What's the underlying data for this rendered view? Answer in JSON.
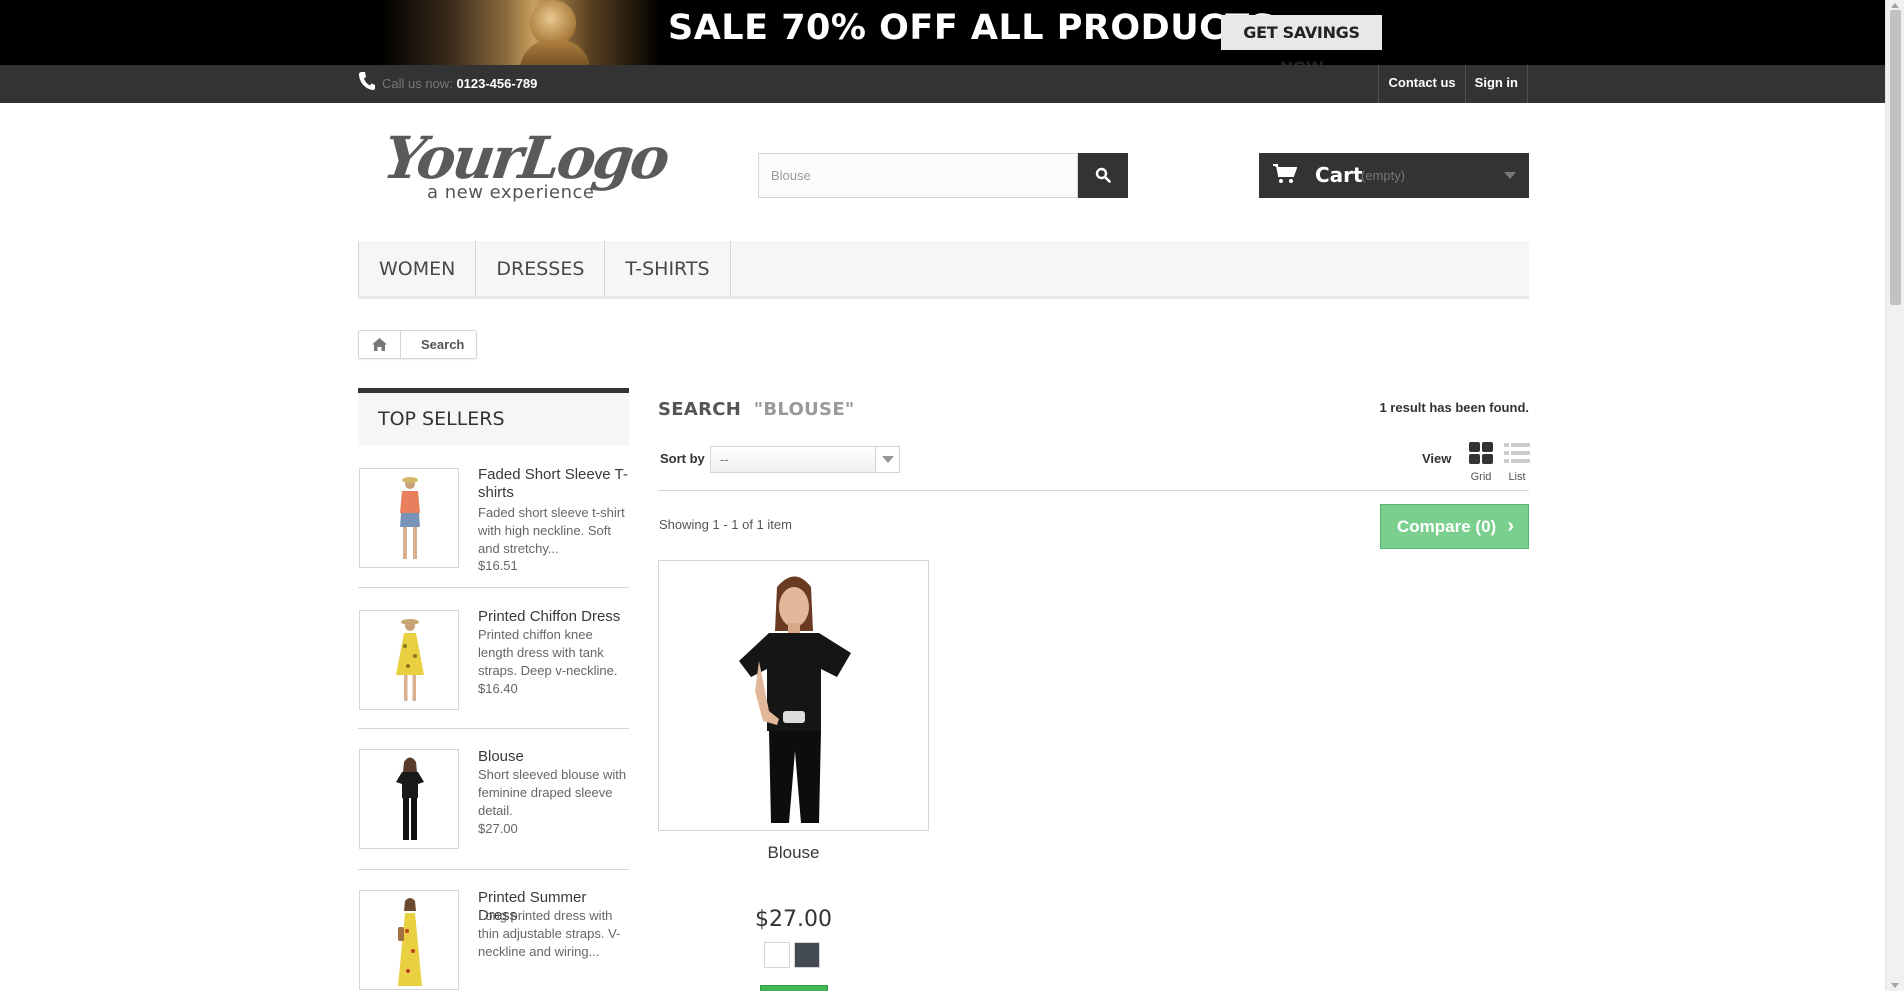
{
  "banner": {
    "text": "SALE 70% OFF ALL PRODUCTS",
    "button": "GET SAVINGS NOW"
  },
  "topbar": {
    "call_label": "Call us now:",
    "phone": "0123-456-789",
    "contact": "Contact us",
    "signin": "Sign in"
  },
  "logo": {
    "main": "YourLogo",
    "tagline": "a new experience"
  },
  "search": {
    "value": "Blouse"
  },
  "cart": {
    "label": "Cart",
    "status": "(empty)"
  },
  "menu": [
    "WOMEN",
    "DRESSES",
    "T-SHIRTS"
  ],
  "breadcrumb": {
    "current": "Search"
  },
  "sidebar": {
    "title": "TOP SELLERS",
    "items": [
      {
        "name": "Faded Short Sleeve T-shirts",
        "desc": "Faded short sleeve t-shirt with high neckline. Soft and stretchy...",
        "price": "$16.51"
      },
      {
        "name": "Printed Chiffon Dress",
        "desc": "Printed chiffon knee length dress with tank straps. Deep v-neckline.",
        "price": "$16.40"
      },
      {
        "name": "Blouse",
        "desc": "Short sleeved blouse with feminine draped sleeve detail.",
        "price": "$27.00"
      },
      {
        "name": "Printed Summer Dress",
        "desc": "Long printed dress with thin adjustable straps. V-neckline and wiring...",
        "price": ""
      }
    ]
  },
  "main": {
    "title": "SEARCH",
    "query": "\"BLOUSE\"",
    "result_count": "1 result has been found.",
    "sort_label": "Sort by",
    "sort_value": "--",
    "view_label": "View",
    "view_grid": "Grid",
    "view_list": "List",
    "showing": "Showing 1 - 1 of 1 item",
    "compare": "Compare (0)"
  },
  "product": {
    "name": "Blouse",
    "price": "$27.00",
    "colors": [
      "#ffffff",
      "#434a54"
    ]
  },
  "colors": {
    "accent_green": "#43b754",
    "compare_green": "#7bcf8e",
    "dark": "#333333"
  }
}
